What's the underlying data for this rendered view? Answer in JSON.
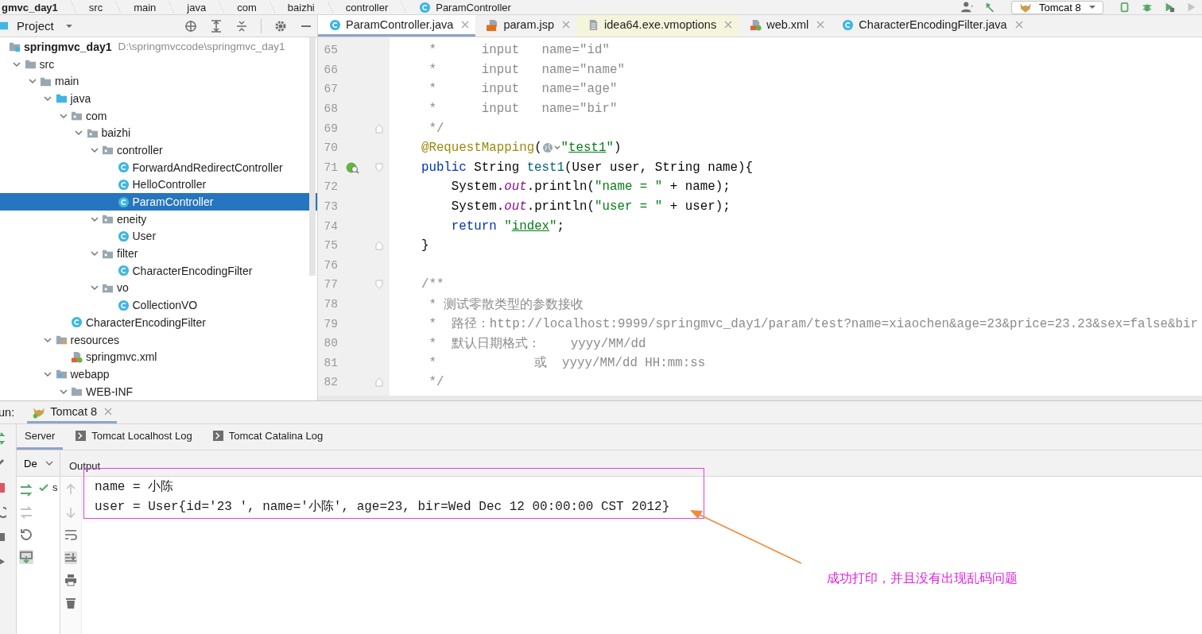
{
  "breadcrumb": [
    {
      "label": "gmvc_day1",
      "kind": "module"
    },
    {
      "label": "src",
      "kind": "folder"
    },
    {
      "label": "main",
      "kind": "folder"
    },
    {
      "label": "java",
      "kind": "folder"
    },
    {
      "label": "com",
      "kind": "folder"
    },
    {
      "label": "baizhi",
      "kind": "folder"
    },
    {
      "label": "controller",
      "kind": "folder"
    },
    {
      "label": "ParamController",
      "kind": "class"
    }
  ],
  "run_config": {
    "label": "Tomcat 8"
  },
  "project": {
    "title": "Project",
    "tree": [
      {
        "label": "springmvc_day1",
        "path": "D:\\springmvccode\\springmvc_day1",
        "kind": "module",
        "selected": false,
        "children": [
          {
            "label": "src",
            "kind": "folder",
            "expanded": true,
            "selected": false,
            "children": [
              {
                "label": "main",
                "kind": "folder",
                "expanded": true,
                "selected": false,
                "children": [
                  {
                    "label": "java",
                    "kind": "source",
                    "expanded": true,
                    "selected": false,
                    "children": [
                      {
                        "label": "com",
                        "kind": "package",
                        "expanded": true,
                        "selected": false,
                        "children": [
                          {
                            "label": "baizhi",
                            "kind": "package",
                            "expanded": true,
                            "selected": false,
                            "children": [
                              {
                                "label": "controller",
                                "kind": "package",
                                "expanded": true,
                                "selected": false,
                                "children": [
                                  {
                                    "label": "ForwardAndRedirectController",
                                    "kind": "class",
                                    "selected": false
                                  },
                                  {
                                    "label": "HelloController",
                                    "kind": "class",
                                    "selected": false
                                  },
                                  {
                                    "label": "ParamController",
                                    "kind": "class",
                                    "selected": true
                                  }
                                ]
                              },
                              {
                                "label": "eneity",
                                "kind": "package",
                                "expanded": true,
                                "selected": false,
                                "children": [
                                  {
                                    "label": "User",
                                    "kind": "class",
                                    "selected": false
                                  }
                                ]
                              },
                              {
                                "label": "filter",
                                "kind": "package",
                                "expanded": true,
                                "selected": false,
                                "children": [
                                  {
                                    "label": "CharacterEncodingFilter",
                                    "kind": "class",
                                    "selected": false
                                  }
                                ]
                              },
                              {
                                "label": "vo",
                                "kind": "package",
                                "expanded": true,
                                "selected": false,
                                "children": [
                                  {
                                    "label": "CollectionVO",
                                    "kind": "class",
                                    "selected": false
                                  }
                                ]
                              }
                            ]
                          }
                        ]
                      },
                      {
                        "label": "CharacterEncodingFilter",
                        "kind": "class",
                        "selected": false
                      }
                    ]
                  },
                  {
                    "label": "resources",
                    "kind": "resources",
                    "expanded": true,
                    "selected": false,
                    "children": [
                      {
                        "label": "springmvc.xml",
                        "kind": "xml",
                        "selected": false
                      }
                    ]
                  },
                  {
                    "label": "webapp",
                    "kind": "webapp",
                    "expanded": true,
                    "selected": false,
                    "children": [
                      {
                        "label": "WEB-INF",
                        "kind": "folder",
                        "expanded": true,
                        "selected": false
                      }
                    ]
                  }
                ]
              }
            ]
          }
        ]
      }
    ]
  },
  "editor_tabs": [
    {
      "label": "ParamController.java",
      "kind": "class",
      "selected": true
    },
    {
      "label": "param.jsp",
      "kind": "jsp",
      "selected": false
    },
    {
      "label": "idea64.exe.vmoptions",
      "kind": "text",
      "selected": false
    },
    {
      "label": "web.xml",
      "kind": "xml",
      "selected": false
    },
    {
      "label": "CharacterEncodingFilter.java",
      "kind": "class",
      "selected": false
    }
  ],
  "code": [
    {
      "number": "65",
      "segments": [
        {
          "kind": "comment",
          "text": "     *      input   name=\"id\""
        }
      ]
    },
    {
      "number": "66",
      "segments": [
        {
          "kind": "comment",
          "text": "     *      input   name=\"name\""
        }
      ]
    },
    {
      "number": "67",
      "segments": [
        {
          "kind": "comment",
          "text": "     *      input   name=\"age\""
        }
      ]
    },
    {
      "number": "68",
      "segments": [
        {
          "kind": "comment",
          "text": "     *      input   name=\"bir\""
        }
      ]
    },
    {
      "number": "69",
      "kind": "fold-end",
      "segments": [
        {
          "kind": "comment",
          "text": "     */"
        }
      ]
    },
    {
      "number": "70",
      "segments": [
        {
          "kind": "annotation",
          "text": "    @RequestMapping"
        },
        {
          "kind": "plain",
          "text": "("
        },
        {
          "kind": "url-icon"
        },
        {
          "kind": "string",
          "text": "\""
        },
        {
          "kind": "link",
          "text": "test1"
        },
        {
          "kind": "string",
          "text": "\""
        },
        {
          "kind": "plain",
          "text": ")"
        }
      ]
    },
    {
      "number": "71",
      "kind": "fold-start",
      "marker": true,
      "segments": [
        {
          "kind": "keyword",
          "text": "    public"
        },
        {
          "kind": "plain",
          "text": " String "
        },
        {
          "kind": "method",
          "text": "test1"
        },
        {
          "kind": "plain",
          "text": "(User user, String name){"
        }
      ]
    },
    {
      "number": "72",
      "segments": [
        {
          "kind": "plain",
          "text": "        System."
        },
        {
          "kind": "field",
          "text": "out"
        },
        {
          "kind": "plain",
          "text": ".println("
        },
        {
          "kind": "string",
          "text": "\"name = \""
        },
        {
          "kind": "plain",
          "text": " + name);"
        }
      ]
    },
    {
      "number": "73",
      "segments": [
        {
          "kind": "plain",
          "text": "        System."
        },
        {
          "kind": "field",
          "text": "out"
        },
        {
          "kind": "plain",
          "text": ".println("
        },
        {
          "kind": "string",
          "text": "\"user = \""
        },
        {
          "kind": "plain",
          "text": " + user);"
        }
      ]
    },
    {
      "number": "74",
      "segments": [
        {
          "kind": "keyword",
          "text": "        return"
        },
        {
          "kind": "string",
          "text": " \""
        },
        {
          "kind": "link",
          "text": "index"
        },
        {
          "kind": "string",
          "text": "\""
        },
        {
          "kind": "plain",
          "text": ";"
        }
      ]
    },
    {
      "number": "75",
      "kind": "fold-end",
      "segments": [
        {
          "kind": "plain",
          "text": "    }"
        }
      ]
    },
    {
      "number": "76"
    },
    {
      "number": "77",
      "kind": "fold-start",
      "segments": [
        {
          "kind": "comment",
          "text": "    /**"
        }
      ]
    },
    {
      "number": "78",
      "segments": [
        {
          "kind": "comment",
          "text": "     * 测试零散类型的参数接收"
        }
      ]
    },
    {
      "number": "79",
      "segments": [
        {
          "kind": "comment",
          "text": "     *  路径：http://localhost:9999/springmvc_day1/param/test?name=xiaochen&age=23&price=23.23&sex=false&bir"
        }
      ]
    },
    {
      "number": "80",
      "segments": [
        {
          "kind": "comment",
          "text": "     *  默认日期格式：    yyyy/MM/dd"
        }
      ]
    },
    {
      "number": "81",
      "segments": [
        {
          "kind": "comment",
          "text": "     *             或  yyyy/MM/dd HH:mm:ss"
        }
      ]
    },
    {
      "number": "82",
      "kind": "fold-end",
      "segments": [
        {
          "kind": "comment",
          "text": "     */"
        }
      ]
    }
  ],
  "run_panel": {
    "label": "un:",
    "tabs": [
      {
        "label": "Tomcat 8",
        "selected": true
      }
    ],
    "subtabs": [
      {
        "label": "Server",
        "kind": "plain",
        "selected": true
      },
      {
        "label": "Tomcat Localhost Log",
        "kind": "log",
        "selected": false
      },
      {
        "label": "Tomcat Catalina Log",
        "kind": "log",
        "selected": false
      }
    ],
    "services_dropdown": "De",
    "output_title": "Output",
    "service_item": "s",
    "output": [
      "name = 小陈",
      "user = User{id='23 ', name='小陈', age=23, bir=Wed Dec 12 00:00:00 CST 2012}"
    ]
  },
  "annotation": {
    "text": "成功打印，并且没有出现乱码问题"
  }
}
